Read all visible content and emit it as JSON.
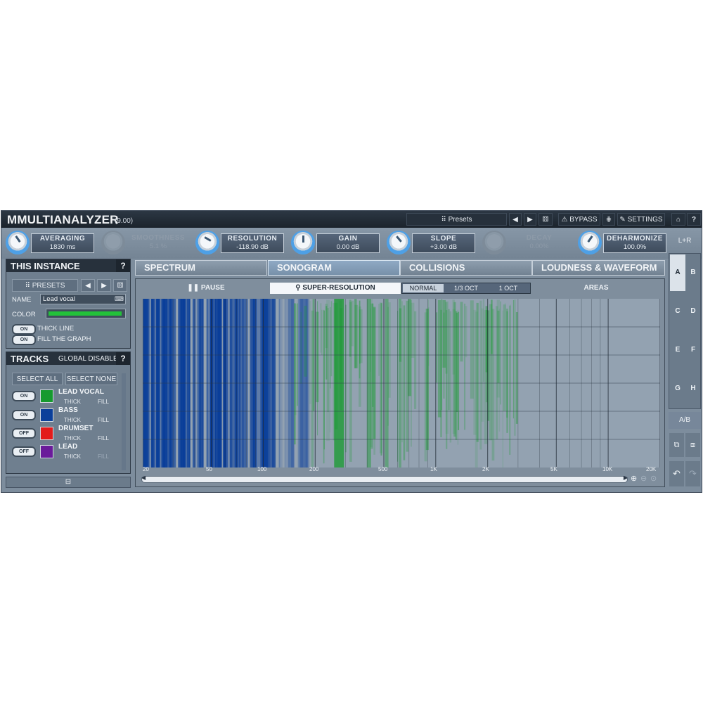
{
  "app": {
    "title": "MMULTIANALYZER",
    "version": "(9.00)"
  },
  "titlebar": {
    "presets": "Presets",
    "bypass": "BYPASS",
    "settings": "SETTINGS",
    "help": "?"
  },
  "knobs": [
    {
      "label": "AVERAGING",
      "value": "1830 ms",
      "active": true
    },
    {
      "label": "SMOOTHNESS",
      "value": "5.1 %",
      "active": false
    },
    {
      "label": "RESOLUTION",
      "value": "-118.90 dB",
      "active": true
    },
    {
      "label": "GAIN",
      "value": "0.00 dB",
      "active": true
    },
    {
      "label": "SLOPE",
      "value": "+3.00 dB",
      "active": true
    },
    {
      "label": "DECAY",
      "value": "0.00%",
      "active": false
    },
    {
      "label": "DEHARMONIZE",
      "value": "100.0%",
      "active": true
    }
  ],
  "this_instance": {
    "title": "THIS INSTANCE",
    "help": "?",
    "presets": "PRESETS",
    "name_label": "NAME",
    "name_value": "Lead vocal",
    "color_label": "COLOR",
    "thick_line": "THICK LINE",
    "fill_graph": "FILL THE GRAPH",
    "on": "ON"
  },
  "tracks": {
    "title": "TRACKS",
    "global_disable": "GLOBAL DISABLE",
    "help": "?",
    "select_all": "SELECT ALL",
    "select_none": "SELECT NONE",
    "thick": "THICK",
    "fill": "FILL",
    "items": [
      {
        "name": "LEAD VOCAL",
        "toggle": "ON",
        "color": "#169a2e"
      },
      {
        "name": "BASS",
        "toggle": "ON",
        "color": "#0b3f9a"
      },
      {
        "name": "DRUMSET",
        "toggle": "OFF",
        "color": "#e31b1b"
      },
      {
        "name": "LEAD",
        "toggle": "OFF",
        "color": "#6a1b9a"
      }
    ]
  },
  "tabs": [
    "SPECTRUM",
    "SONOGRAM",
    "COLLISIONS",
    "LOUDNESS & WAVEFORM"
  ],
  "graph_toolbar": {
    "pause": "PAUSE",
    "super_resolution": "SUPER-RESOLUTION",
    "modes": [
      "NORMAL",
      "1/3 OCT",
      "1 OCT"
    ],
    "areas": "AREAS"
  },
  "freq_axis": [
    "20",
    "50",
    "100",
    "200",
    "500",
    "1K",
    "2K",
    "5K",
    "10K",
    "20K"
  ],
  "right_panel": {
    "channel": "L+R",
    "slots": [
      "A",
      "B",
      "C",
      "D",
      "E",
      "F",
      "G",
      "H"
    ],
    "ab": "A/B"
  },
  "colors": {
    "accent": "#4ea0e6",
    "bass": "#0b3f9a",
    "vocal": "#169a2e"
  }
}
